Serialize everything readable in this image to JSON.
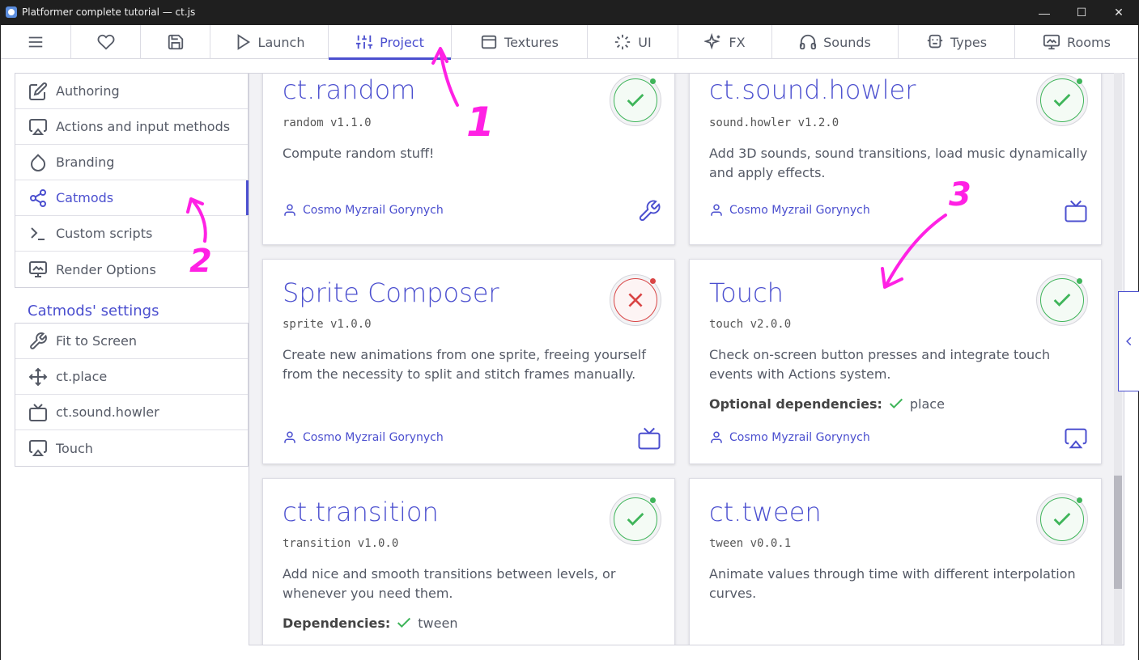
{
  "window": {
    "title": "Platformer complete tutorial — ct.js",
    "controls": [
      "—",
      "☐",
      "✕"
    ]
  },
  "topnav": {
    "tabs": [
      {
        "label": "",
        "icon": "menu-icon"
      },
      {
        "label": "",
        "icon": "heart-icon"
      },
      {
        "label": "",
        "icon": "save-icon"
      },
      {
        "label": "Launch",
        "icon": "play-icon"
      },
      {
        "label": "Project",
        "icon": "sliders-icon",
        "active": true
      },
      {
        "label": "Textures",
        "icon": "texture-icon"
      },
      {
        "label": "UI",
        "icon": "ui-icon"
      },
      {
        "label": "FX",
        "icon": "sparkles-icon"
      },
      {
        "label": "Sounds",
        "icon": "headphones-icon"
      },
      {
        "label": "Types",
        "icon": "types-icon"
      },
      {
        "label": "Rooms",
        "icon": "room-icon"
      }
    ]
  },
  "sidebar": {
    "items": [
      {
        "label": "Authoring",
        "icon": "edit-icon"
      },
      {
        "label": "Actions and input methods",
        "icon": "airplay-icon"
      },
      {
        "label": "Branding",
        "icon": "droplet-icon"
      },
      {
        "label": "Catmods",
        "icon": "share-icon",
        "active": true
      },
      {
        "label": "Custom scripts",
        "icon": "terminal-icon"
      },
      {
        "label": "Render Options",
        "icon": "monitor-icon"
      }
    ],
    "settings_title": "Catmods' settings",
    "settings_items": [
      {
        "label": "Fit to Screen",
        "icon": "wrench-icon"
      },
      {
        "label": "ct.place",
        "icon": "move-icon"
      },
      {
        "label": "ct.sound.howler",
        "icon": "tv-icon"
      },
      {
        "label": "Touch",
        "icon": "airplay-icon"
      }
    ]
  },
  "catmods": [
    {
      "name": "ct.random",
      "version": "random v1.1.0",
      "description": "Compute random stuff!",
      "author": "Cosmo Myzrail Gorynych",
      "enabled": true,
      "icon": "wrench-icon"
    },
    {
      "name": "ct.sound.howler",
      "version": "sound.howler v1.2.0",
      "description": "Add 3D sounds, sound transitions, load music dynamically and apply effects.",
      "author": "Cosmo Myzrail Gorynych",
      "enabled": true,
      "icon": "tv-icon"
    },
    {
      "name": "Sprite Composer",
      "version": "sprite v1.0.0",
      "description": "Create new animations from one sprite, freeing yourself from the necessity to split and stitch frames manually.",
      "author": "Cosmo Myzrail Gorynych",
      "enabled": false,
      "icon": "tv-icon"
    },
    {
      "name": "Touch",
      "version": "touch v2.0.0",
      "description": "Check on-screen button presses and integrate touch events with Actions system.",
      "deps_label": "Optional dependencies:",
      "deps": "place",
      "author": "Cosmo Myzrail Gorynych",
      "enabled": true,
      "icon": "airplay-icon"
    },
    {
      "name": "ct.transition",
      "version": "transition v1.0.0",
      "description": "Add nice and smooth transitions between levels, or whenever you need them.",
      "deps_label": "Dependencies:",
      "deps": "tween",
      "enabled": true
    },
    {
      "name": "ct.tween",
      "version": "tween v0.0.1",
      "description": "Animate values through time with different interpolation curves.",
      "enabled": true
    }
  ],
  "annotations": [
    "1",
    "2",
    "3"
  ],
  "colors": {
    "accent": "#4b4fcf",
    "enabled": "#3fb55a",
    "disabled": "#d94545",
    "annotation": "#ff21e4"
  }
}
